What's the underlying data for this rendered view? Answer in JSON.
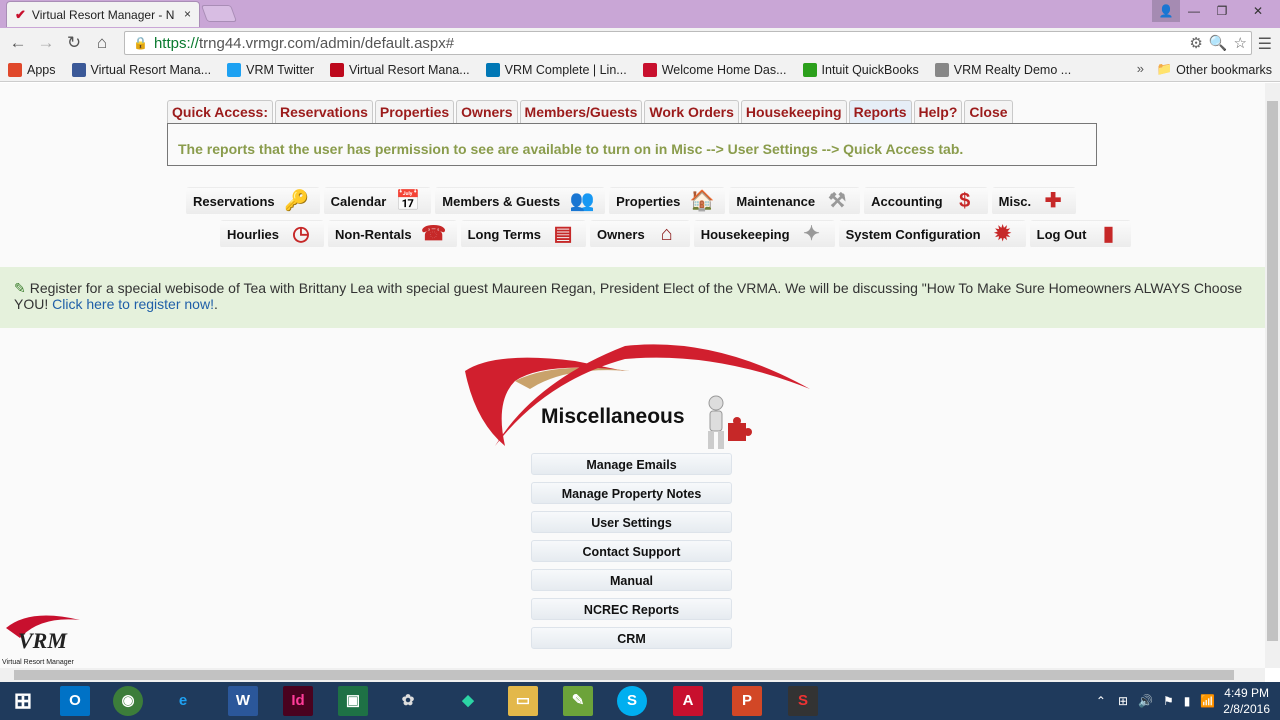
{
  "browser": {
    "tab_title": "Virtual Resort Manager - N",
    "tab_close": "×",
    "url_https": "https://",
    "url_rest": "trng44.vrmgr.com/admin/default.aspx#",
    "bookmarks": [
      {
        "label": "Apps",
        "icon": "apps-icon",
        "color": "#e0482b"
      },
      {
        "label": "Virtual Resort Mana...",
        "icon": "facebook-icon",
        "color": "#3b5998"
      },
      {
        "label": "VRM Twitter",
        "icon": "twitter-icon",
        "color": "#1da1f2"
      },
      {
        "label": "Virtual Resort Mana...",
        "icon": "pinterest-icon",
        "color": "#bd081c"
      },
      {
        "label": "VRM Complete | Lin...",
        "icon": "linkedin-icon",
        "color": "#0077b5"
      },
      {
        "label": "Welcome Home Das...",
        "icon": "vrm-check-icon",
        "color": "#c8102e"
      },
      {
        "label": "Intuit QuickBooks",
        "icon": "quickbooks-icon",
        "color": "#2ca01c"
      },
      {
        "label": "VRM Realty Demo ...",
        "icon": "page-icon",
        "color": "#888888"
      }
    ],
    "bookmarks_more": "»",
    "other_bookmarks": "Other bookmarks"
  },
  "quick_access": {
    "label": "Quick Access:",
    "tabs": [
      "Reservations",
      "Properties",
      "Owners",
      "Members/Guests",
      "Work Orders",
      "Housekeeping",
      "Reports",
      "Help?",
      "Close"
    ],
    "active_tab": "Reports",
    "message": "The reports that the user has permission to see are available to turn on in Misc --> User Settings --> Quick Access tab."
  },
  "nav_row1": [
    "Reservations",
    "Calendar",
    "Members & Guests",
    "Properties",
    "Maintenance",
    "Accounting",
    "Misc."
  ],
  "nav_row2": [
    "Hourlies",
    "Non-Rentals",
    "Long Terms",
    "Owners",
    "Housekeeping",
    "System Configuration",
    "Log Out"
  ],
  "announcement": {
    "text": "Register for a special webisode of Tea with Brittany Lea with special guest Maureen Regan, President Elect of the VRMA. We will be discussing \"How To Make Sure Homeowners ALWAYS Choose YOU!",
    "link": "Click here to register now!",
    "after": "."
  },
  "misc": {
    "title": "Miscellaneous",
    "items": [
      "Manage Emails",
      "Manage Property Notes",
      "User Settings",
      "Contact Support",
      "Manual",
      "NCREC Reports",
      "CRM"
    ]
  },
  "logo": {
    "text": "VRM",
    "sub": "Virtual Resort Manager"
  },
  "taskbar": {
    "time": "4:49 PM",
    "date": "2/8/2016"
  },
  "colors": {
    "accent_red": "#c8102e",
    "quick_access_text": "#9b1b1b",
    "message_text": "#8a9c4c",
    "announcement_bg": "#e5f1dc"
  }
}
